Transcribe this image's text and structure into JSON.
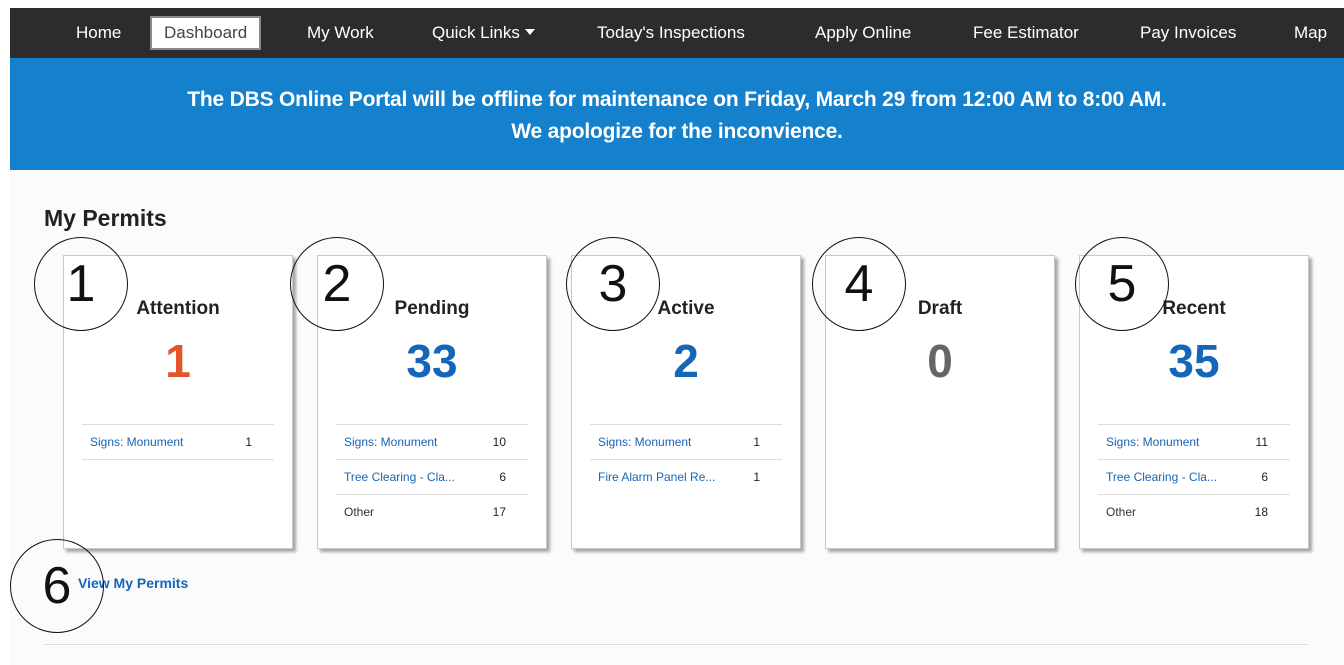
{
  "nav": {
    "items": [
      "Home",
      "Dashboard",
      "My Work",
      "Quick Links",
      "Today's Inspections",
      "Apply Online",
      "Fee Estimator",
      "Pay Invoices",
      "Map"
    ],
    "active": "Dashboard"
  },
  "banner": {
    "line1": "The DBS Online Portal will be offline for maintenance on Friday, March 29 from 12:00 AM to 8:00 AM.",
    "line2": "We apologize for the inconvience."
  },
  "section": {
    "title": "My Permits"
  },
  "cards": [
    {
      "title": "Attention",
      "count": "1",
      "count_color": "#e5532d",
      "rows": [
        {
          "label": "Signs: Monument",
          "value": "1",
          "link": true
        }
      ]
    },
    {
      "title": "Pending",
      "count": "33",
      "count_color": "#1565b8",
      "rows": [
        {
          "label": "Signs: Monument",
          "value": "10",
          "link": true
        },
        {
          "label": "Tree Clearing - Cla...",
          "value": "6",
          "link": true
        },
        {
          "label": "Other",
          "value": "17",
          "link": false
        }
      ]
    },
    {
      "title": "Active",
      "count": "2",
      "count_color": "#1565b8",
      "rows": [
        {
          "label": "Signs: Monument",
          "value": "1",
          "link": true
        },
        {
          "label": "Fire Alarm Panel Re...",
          "value": "1",
          "link": true
        }
      ]
    },
    {
      "title": "Draft",
      "count": "0",
      "count_color": "#666666",
      "rows": []
    },
    {
      "title": "Recent",
      "count": "35",
      "count_color": "#1565b8",
      "rows": [
        {
          "label": "Signs: Monument",
          "value": "11",
          "link": true
        },
        {
          "label": "Tree Clearing - Cla...",
          "value": "6",
          "link": true
        },
        {
          "label": "Other",
          "value": "18",
          "link": false
        }
      ]
    }
  ],
  "view_link": "View My Permits",
  "callouts": [
    "1",
    "2",
    "3",
    "4",
    "5",
    "6"
  ]
}
